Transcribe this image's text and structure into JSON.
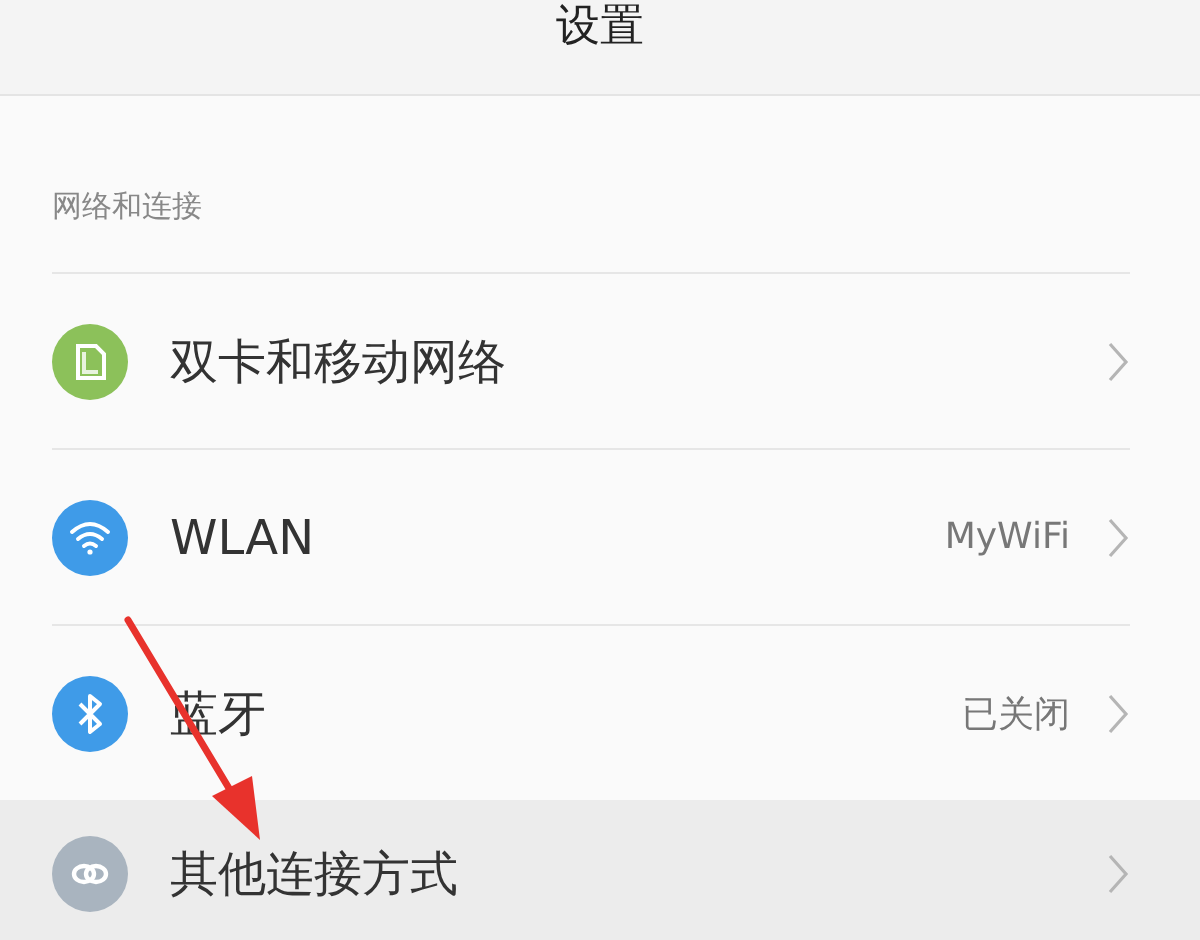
{
  "header": {
    "title": "设置"
  },
  "section": {
    "title": "网络和连接"
  },
  "items": [
    {
      "kind": "sim",
      "label": "双卡和移动网络",
      "color": "#8cc15a",
      "selected": false
    },
    {
      "kind": "wifi",
      "label": "WLAN",
      "value": "MyWiFi",
      "color": "#3f9be8",
      "selected": false
    },
    {
      "kind": "bluetooth",
      "label": "蓝牙",
      "value": "已关闭",
      "color": "#3f9be8",
      "selected": false
    },
    {
      "kind": "link",
      "label": "其他连接方式",
      "color": "#a9b4bf",
      "selected": true
    }
  ]
}
